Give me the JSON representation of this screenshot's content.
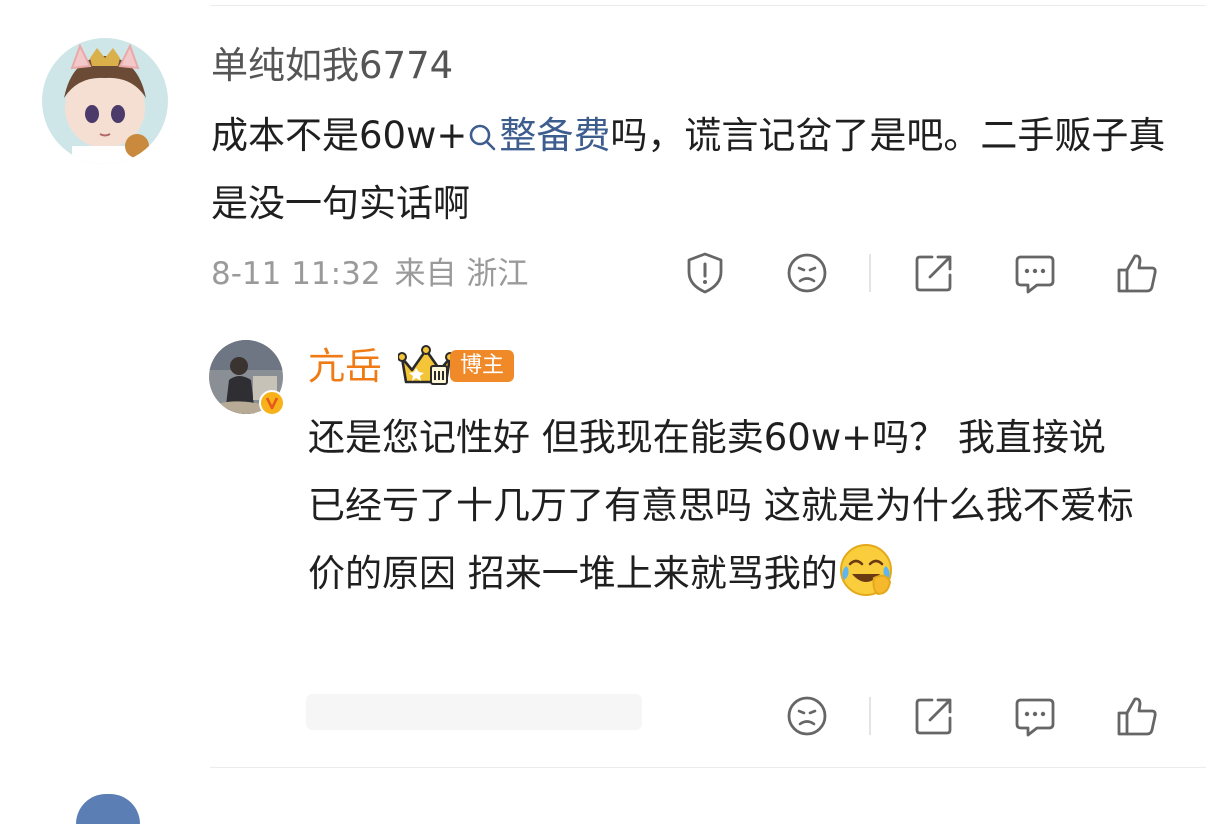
{
  "comment": {
    "username": "单纯如我6774",
    "text_before": "成本不是60w+",
    "topic": "整备费",
    "text_after": "吗，谎言记岔了是吧。二手贩子真是没一句实话啊",
    "time": "8-11 11:32",
    "source": "来自 浙江",
    "icons": [
      "report-icon",
      "dislike-icon",
      "share-icon",
      "comment-icon",
      "like-icon"
    ]
  },
  "reply": {
    "username": "亢岳",
    "badge": "博主",
    "text": "还是您记性好 但我现在能卖60w+吗？ 我直接说已经亏了十几万了有意思吗 这就是为什么我不爱标价的原因 招来一堆上来就骂我的",
    "emoji": "laugh-cry-emoji",
    "icons": [
      "dislike-icon",
      "share-icon",
      "comment-icon",
      "like-icon"
    ]
  },
  "colors": {
    "username": "#555555",
    "blogger_name": "#f07a14",
    "topic_link": "#3d5d8f",
    "badge_bg": "#f08a29",
    "meta": "#9a9a9a"
  }
}
